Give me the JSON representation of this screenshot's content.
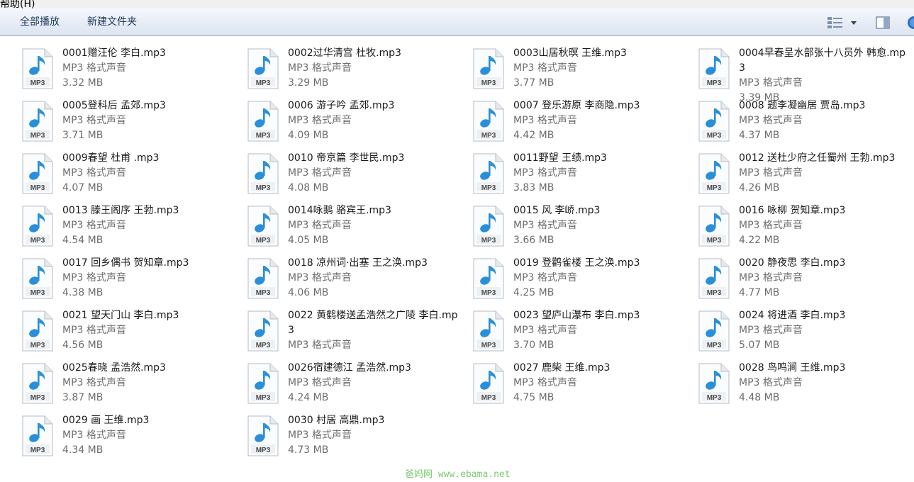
{
  "menubar": {
    "partial_text": "帮助(H)"
  },
  "toolbar": {
    "play_all_label": "全部播放",
    "new_folder_label": "新建文件夹"
  },
  "file_type_label": "MP3 格式声音",
  "icon_badge": "MP3",
  "files": [
    {
      "name": "0001赠汪伦 李白.mp3",
      "size": "3.32 MB"
    },
    {
      "name": "0002过华清宫 杜牧.mp3",
      "size": "3.29 MB"
    },
    {
      "name": "0003山居秋暝 王维.mp3",
      "size": "3.77 MB"
    },
    {
      "name": "0004早春呈水部张十八员外 韩愈.mp3",
      "size": "3.39 MB"
    },
    {
      "name": "0005登科后 孟郊.mp3",
      "size": "3.71 MB"
    },
    {
      "name": "0006 游子吟 孟郊.mp3",
      "size": "4.09 MB"
    },
    {
      "name": "0007 登乐游原 李商隐.mp3",
      "size": "4.42 MB"
    },
    {
      "name": "0008 题李凝幽居 贾岛.mp3",
      "size": "4.37 MB"
    },
    {
      "name": "0009春望 杜甫 .mp3",
      "size": "4.07 MB"
    },
    {
      "name": "0010 帝京篇 李世民.mp3",
      "size": "4.08 MB"
    },
    {
      "name": "0011野望 王绩.mp3",
      "size": "3.83 MB"
    },
    {
      "name": "0012 送杜少府之任蜀州 王勃.mp3",
      "size": "4.26 MB"
    },
    {
      "name": "0013 滕王阁序 王勃.mp3",
      "size": "4.54 MB"
    },
    {
      "name": "0014咏鹅 骆宾王.mp3",
      "size": "4.05 MB"
    },
    {
      "name": "0015 风 李峤.mp3",
      "size": "3.66 MB"
    },
    {
      "name": "0016 咏柳 贺知章.mp3",
      "size": "4.22 MB"
    },
    {
      "name": "0017 回乡偶书 贺知章.mp3",
      "size": "4.38 MB"
    },
    {
      "name": "0018 凉州词·出塞 王之涣.mp3",
      "size": "4.06 MB"
    },
    {
      "name": "0019 登鹳雀楼 王之涣.mp3",
      "size": "4.25 MB"
    },
    {
      "name": "0020 静夜思 李白.mp3",
      "size": "4.77 MB"
    },
    {
      "name": "0021 望天门山 李白.mp3",
      "size": "4.56 MB"
    },
    {
      "name": "0022 黄鹤楼送孟浩然之广陵 李白.mp3",
      "size": ""
    },
    {
      "name": "0023 望庐山瀑布 李白.mp3",
      "size": "3.70 MB"
    },
    {
      "name": "0024 将进酒 李白.mp3",
      "size": "5.07 MB"
    },
    {
      "name": "0025春晓 孟浩然.mp3",
      "size": "3.87 MB"
    },
    {
      "name": "0026宿建德江 孟浩然.mp3",
      "size": "4.24 MB"
    },
    {
      "name": "0027 鹿柴 王维.mp3",
      "size": "4.75 MB"
    },
    {
      "name": "0028 鸟鸣涧 王维.mp3",
      "size": "4.48 MB"
    },
    {
      "name": "0029 画 王维.mp3",
      "size": "4.34 MB"
    },
    {
      "name": "0030 村居 高鼎.mp3",
      "size": "4.73 MB"
    }
  ],
  "watermark": "爸妈网 www.ebama.net"
}
